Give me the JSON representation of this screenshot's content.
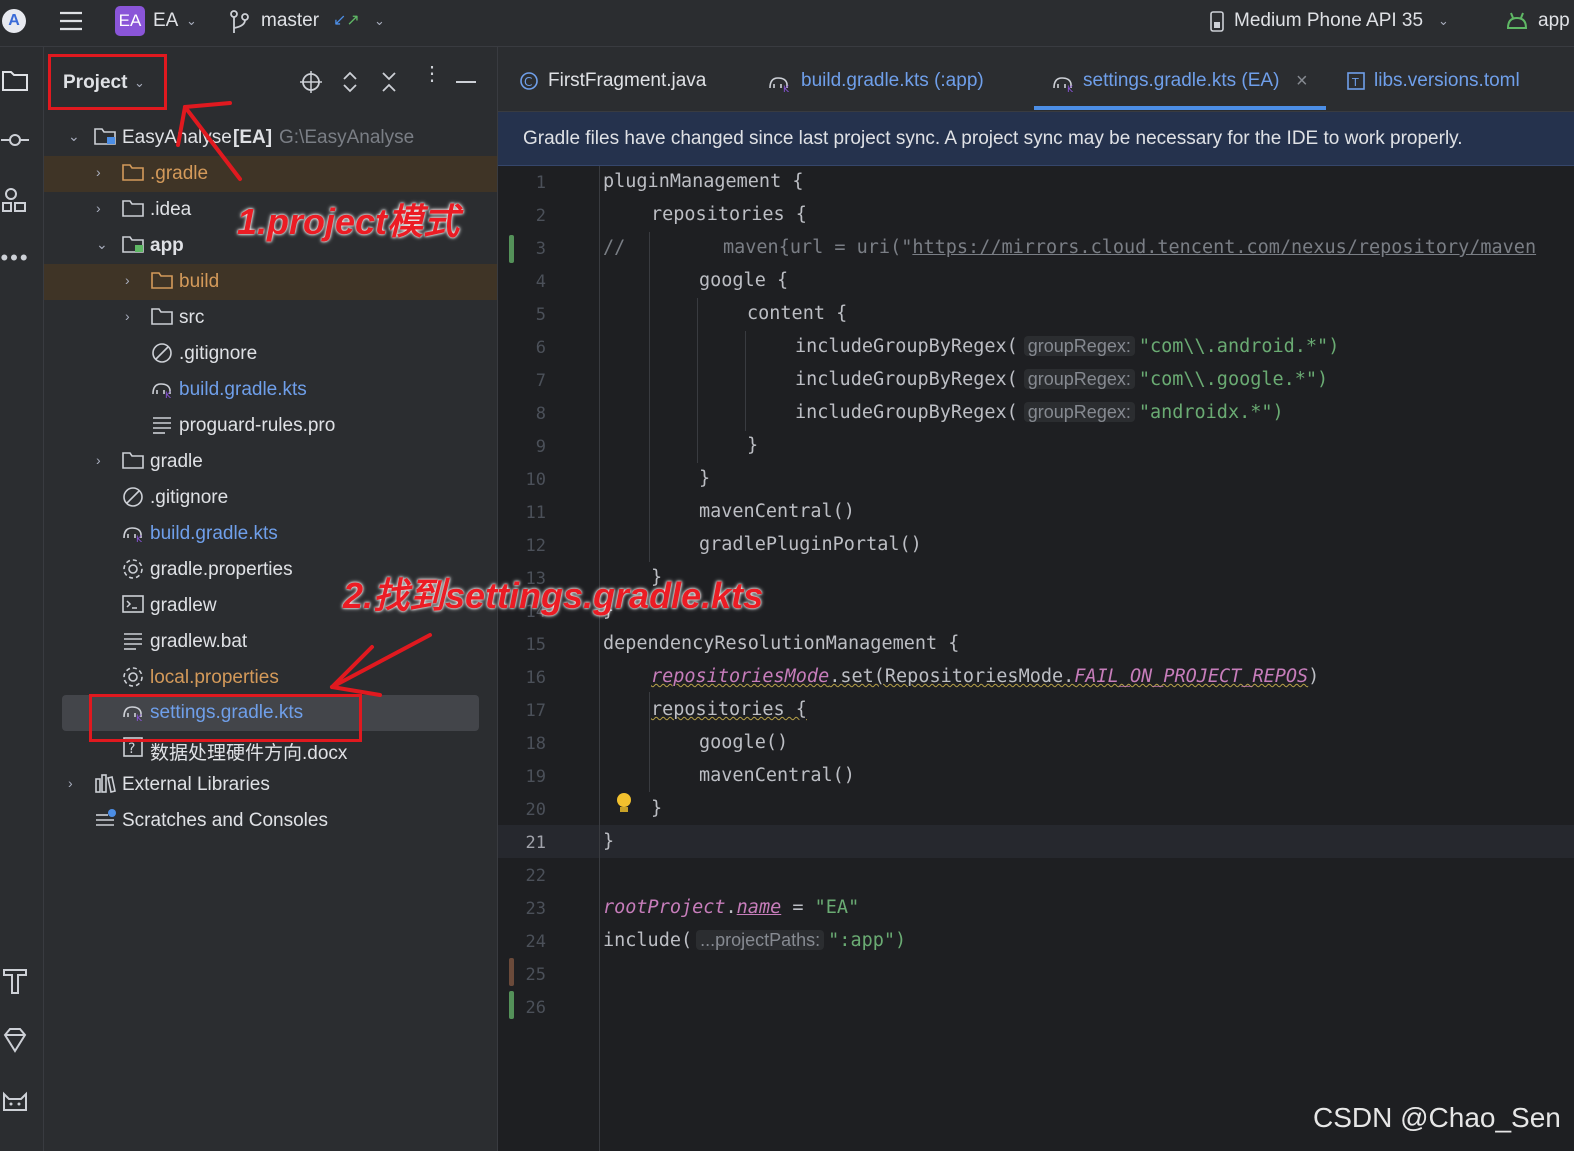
{
  "topbar": {
    "project_badge": "EA",
    "project_name": "EA",
    "branch": "master",
    "device": "Medium Phone API 35",
    "run_config": "app"
  },
  "panel": {
    "title": "Project"
  },
  "tree": {
    "root": {
      "label": "EasyAnalyse",
      "module": "[EA]",
      "path": "G:\\EasyAnalyse"
    },
    "items": [
      {
        "label": ".gradle"
      },
      {
        "label": ".idea"
      },
      {
        "label": "app"
      },
      {
        "label": "build"
      },
      {
        "label": "src"
      },
      {
        "label": ".gitignore"
      },
      {
        "label": "build.gradle.kts"
      },
      {
        "label": "proguard-rules.pro"
      },
      {
        "label": "gradle"
      },
      {
        "label": ".gitignore"
      },
      {
        "label": "build.gradle.kts"
      },
      {
        "label": "gradle.properties"
      },
      {
        "label": "gradlew"
      },
      {
        "label": "gradlew.bat"
      },
      {
        "label": "local.properties"
      },
      {
        "label": "settings.gradle.kts"
      },
      {
        "label": "数据处理硬件方向.docx"
      },
      {
        "label": "External Libraries"
      },
      {
        "label": "Scratches and Consoles"
      }
    ]
  },
  "tabs": [
    {
      "label": "FirstFragment.java"
    },
    {
      "label": "build.gradle.kts (:app)"
    },
    {
      "label": "settings.gradle.kts (EA)"
    },
    {
      "label": "libs.versions.toml"
    }
  ],
  "banner": "Gradle files have changed since last project sync. A project sync may be necessary for the IDE to work properly.",
  "line_numbers": [
    "1",
    "2",
    "3",
    "4",
    "5",
    "6",
    "7",
    "8",
    "9",
    "10",
    "11",
    "12",
    "13",
    "14",
    "15",
    "16",
    "17",
    "18",
    "19",
    "20",
    "21",
    "22",
    "23",
    "24",
    "25",
    "26"
  ],
  "code": {
    "l1": "pluginManagement {",
    "l2": "repositories {",
    "l3_comment": "//",
    "l3_a": "maven{url = uri(\"",
    "l3_url": "https://mirrors.cloud.tencent.com/nexus/repository/maven",
    "l4": "google {",
    "l5": "content {",
    "fn_include": "includeGroupByRegex(",
    "hint_group": "groupRegex:",
    "l6_str": "\"com\\\\.android.*\")",
    "l7_str": "\"com\\\\.google.*\")",
    "l8_str": "\"androidx.*\")",
    "close": "}",
    "l11": "mavenCentral()",
    "l12": "gradlePluginPortal()",
    "l15": "dependencyResolutionManagement {",
    "l16_a": "repositoriesMode",
    "l16_b": ".set(RepositoriesMode.",
    "l16_c": "FAIL_ON_PROJECT_REPOS",
    "l16_d": ")",
    "l17": "repositories {",
    "l18": "google()",
    "l19": "mavenCentral()",
    "l23_a": "rootProject",
    "l23_b": ".",
    "l23_c": "name",
    "l23_d": " = ",
    "l23_e": "\"EA\"",
    "l24_a": "include(",
    "hint_paths": "...projectPaths:",
    "l24_b": "\":app\")"
  },
  "annotations": {
    "step1": "1.project模式",
    "step2": "2.找到settings.gradle.kts"
  },
  "watermark": "CSDN @Chao_Sen",
  "colors": {
    "accent_red": "#e0191f",
    "string_green": "#6aab73",
    "link_blue": "#6f9fea",
    "excluded_orange": "#d49a5a",
    "badge_purple": "#8a55d8"
  }
}
